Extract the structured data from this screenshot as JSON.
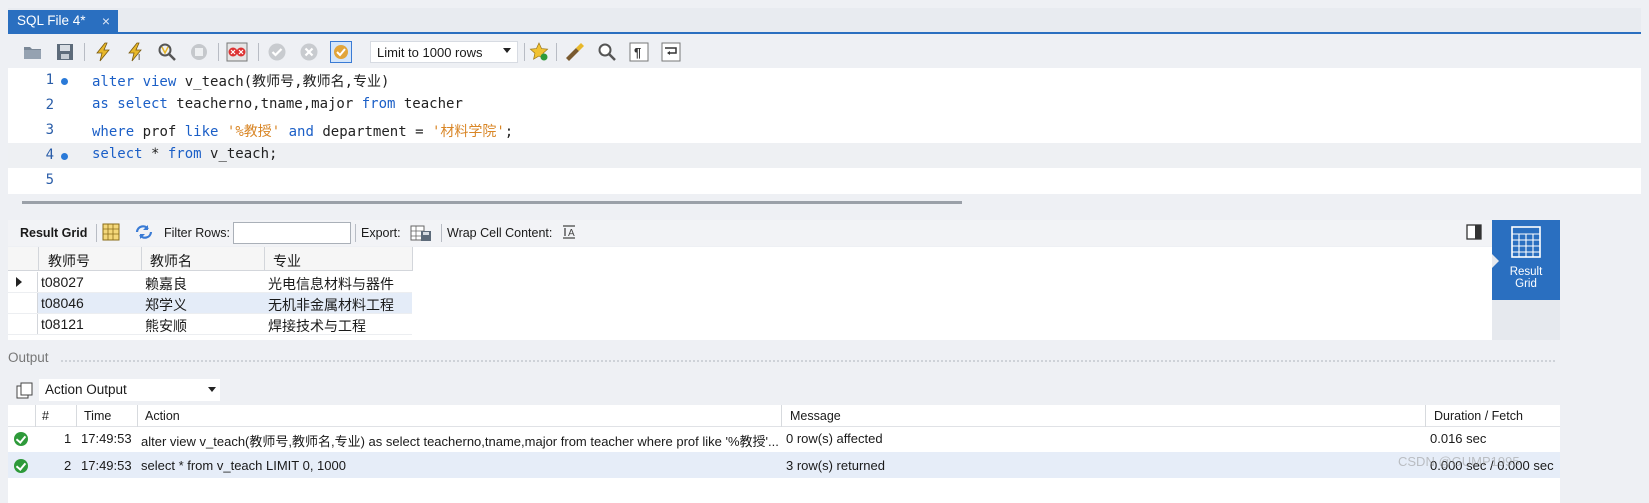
{
  "tab": {
    "title": "SQL File 4*",
    "close": "×"
  },
  "toolbar": {
    "limit_select": "Limit to 1000 rows",
    "icons": [
      "open-folder-icon",
      "save-icon",
      "execute-icon",
      "execute-current-icon",
      "explain-icon",
      "stop-icon",
      "toggle-error-icon",
      "commit-icon",
      "rollback-icon",
      "autocommit-icon",
      "bookmark-star-icon",
      "beautify-icon",
      "find-icon",
      "invisible-chars-icon",
      "wrap-icon"
    ]
  },
  "editor": {
    "lines": [
      {
        "num": "1",
        "dot": true
      },
      {
        "num": "2",
        "dot": false
      },
      {
        "num": "3",
        "dot": false
      },
      {
        "num": "4",
        "dot": true
      },
      {
        "num": "5",
        "dot": false
      }
    ],
    "code": {
      "l1_kw": "alter view",
      "l1_rest": " v_teach(教师号,教师名,专业)",
      "l2_kw1": "as select",
      "l2_mid": " teacherno,tname,major ",
      "l2_kw2": "from",
      "l2_rest": " teacher",
      "l3_kw1": "where",
      "l3_mid1": " prof ",
      "l3_kw2": "like",
      "l3_sp": " ",
      "l3_str1": "'%教授'",
      "l3_sp2": " ",
      "l3_kw3": "and",
      "l3_mid2": " department = ",
      "l3_str2": "'材料学院'",
      "l3_end": ";",
      "l4_kw1": "select",
      "l4_mid": " * ",
      "l4_kw2": "from",
      "l4_rest": " v_teach;"
    }
  },
  "result_toolbar": {
    "result_grid": "Result Grid",
    "filter_rows": "Filter Rows:",
    "filter_value": "",
    "export": "Export:",
    "wrap": "Wrap Cell Content:"
  },
  "side_button": {
    "line1": "Result",
    "line2": "Grid"
  },
  "grid": {
    "columns": [
      "教师号",
      "教师名",
      "专业"
    ],
    "rows": [
      [
        "t08027",
        "赖嘉良",
        "光电信息材料与器件"
      ],
      [
        "t08046",
        "郑学义",
        "无机非金属材料工程"
      ],
      [
        "t08121",
        "熊安顺",
        "焊接技术与工程"
      ]
    ]
  },
  "output": {
    "title": "Output",
    "select": "Action Output",
    "columns": [
      "#",
      "Time",
      "Action",
      "Message",
      "Duration / Fetch"
    ],
    "rows": [
      {
        "num": "1",
        "time": "17:49:53",
        "action": "alter view v_teach(教师号,教师名,专业) as select teacherno,tname,major from teacher where prof like '%教授'...",
        "message": "0 row(s) affected",
        "duration": "0.016 sec"
      },
      {
        "num": "2",
        "time": "17:49:53",
        "action": "select * from v_teach LIMIT 0, 1000",
        "message": "3 row(s) returned",
        "duration": "0.000 sec / 0.000 sec"
      }
    ]
  },
  "watermark": "CSDN @GUMP1995"
}
